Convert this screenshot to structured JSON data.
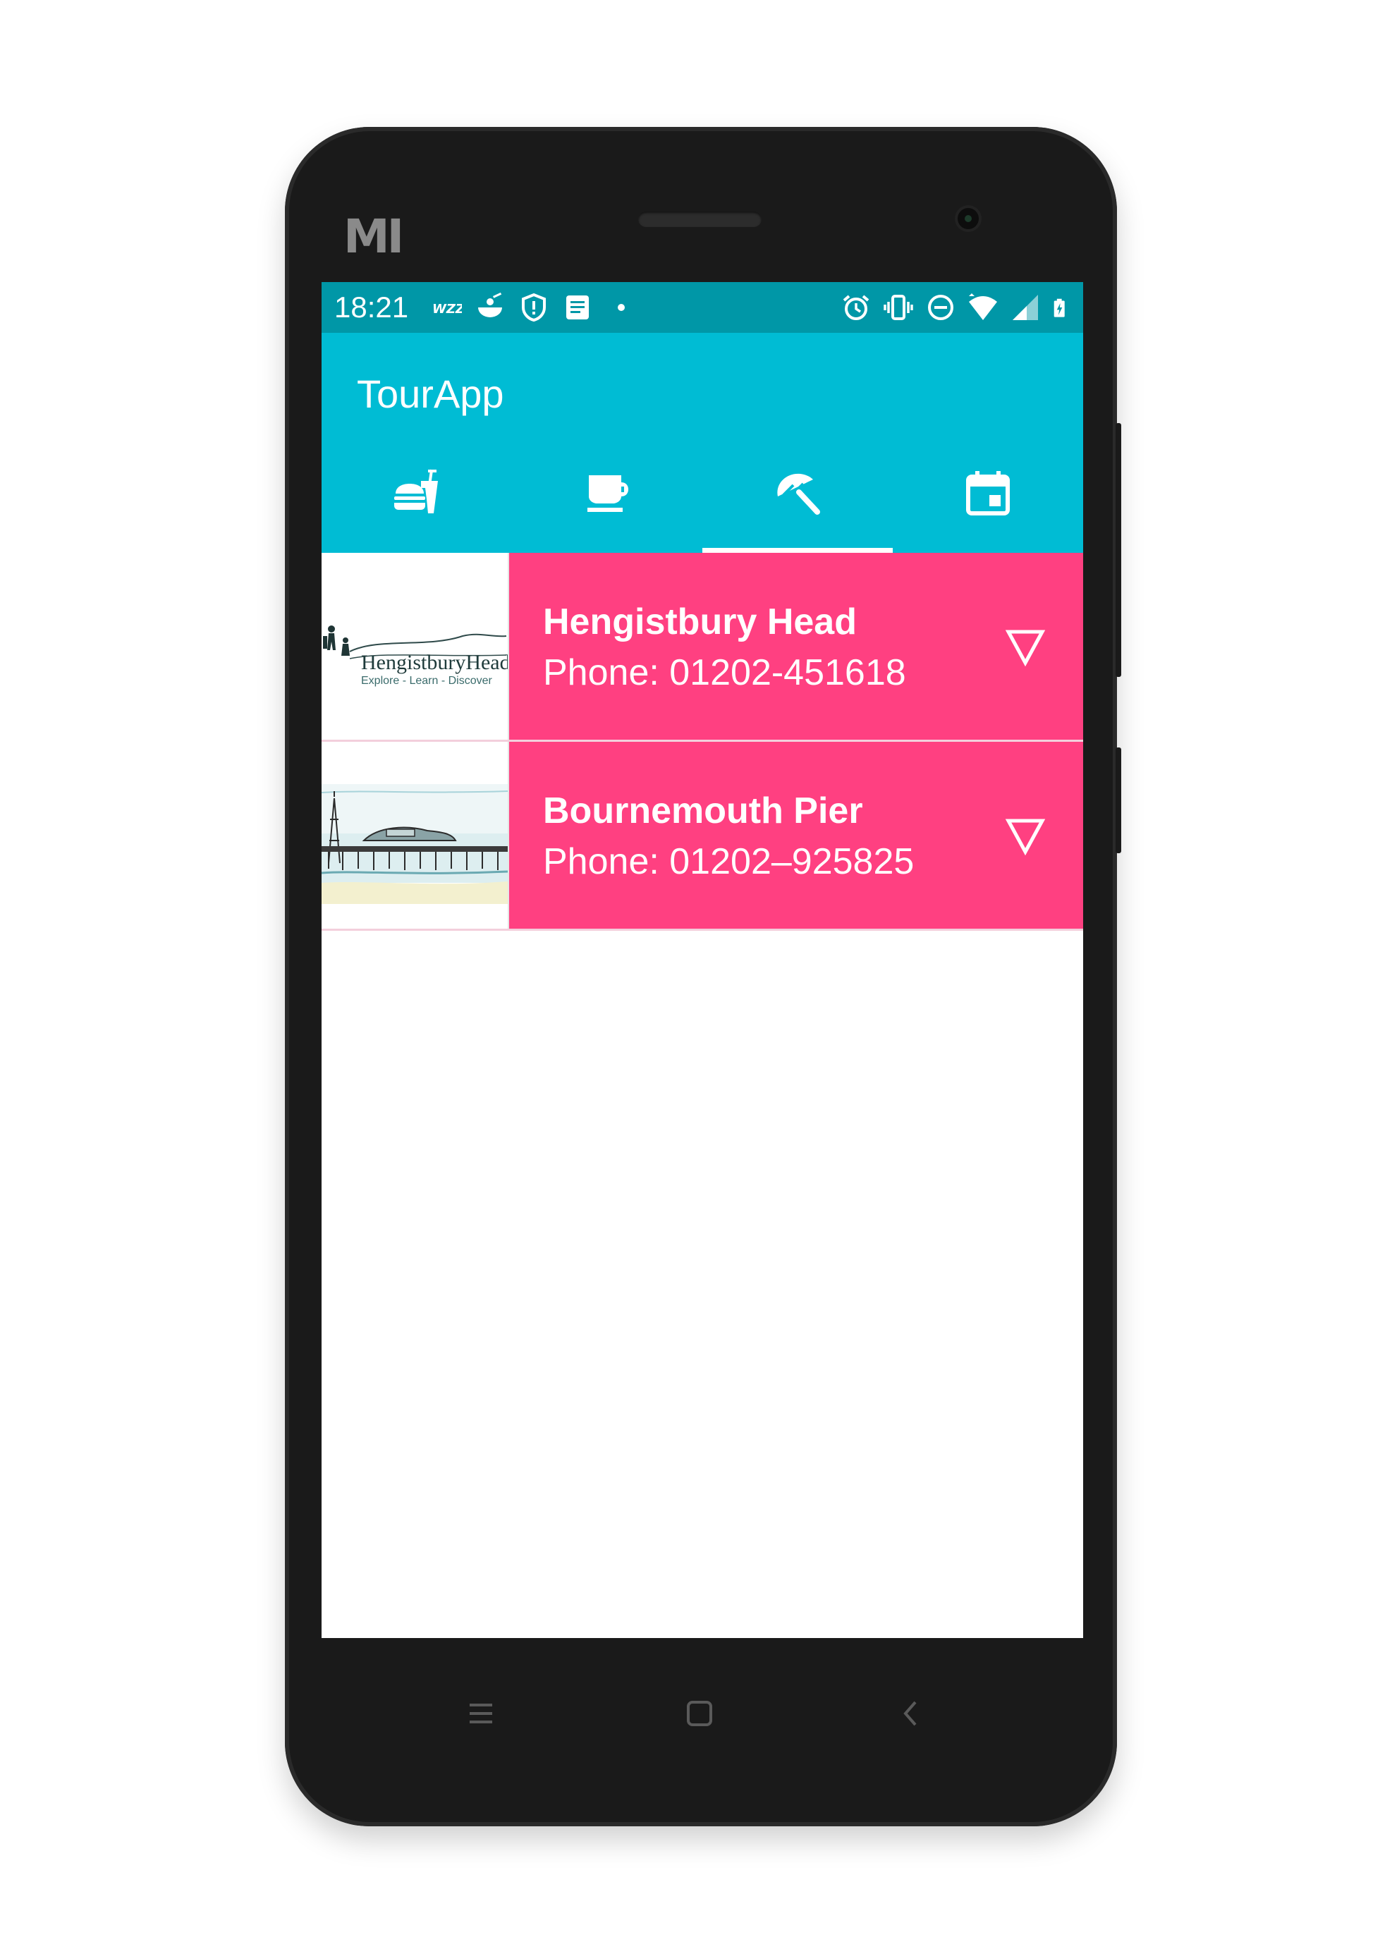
{
  "device": {
    "brand_logo": "MI"
  },
  "status_bar": {
    "time": "18:21",
    "left_icons": [
      "wizz-icon",
      "rice-bowl-icon",
      "shield-icon",
      "document-icon",
      "dot-icon"
    ],
    "right_icons": [
      "alarm-icon",
      "vibrate-icon",
      "do-not-disturb-icon",
      "wifi-icon",
      "signal-icon",
      "battery-charging-icon"
    ]
  },
  "app_bar": {
    "title": "TourApp"
  },
  "tabs": [
    {
      "icon": "fastfood-icon",
      "selected": false
    },
    {
      "icon": "coffee-icon",
      "selected": false
    },
    {
      "icon": "beach-access-icon",
      "selected": true
    },
    {
      "icon": "event-icon",
      "selected": false
    }
  ],
  "places": [
    {
      "name": "Hengistbury Head",
      "phone": "Phone: 01202-451618",
      "logo": {
        "title": "HengistburyHead",
        "tagline": "Explore - Learn - Discover"
      },
      "expand_icon": "triangle-down-icon"
    },
    {
      "name": "Bournemouth Pier",
      "phone": "Phone: 01202–925825",
      "logo": {
        "title": "",
        "tagline": ""
      },
      "expand_icon": "triangle-down-icon"
    }
  ],
  "colors": {
    "status_bar": "#0097a7",
    "app_bar": "#00bcd4",
    "accent": "#ff4081",
    "phone_body": "#1a1a1a"
  },
  "nav_keys": [
    "menu-icon",
    "home-icon",
    "back-icon"
  ]
}
